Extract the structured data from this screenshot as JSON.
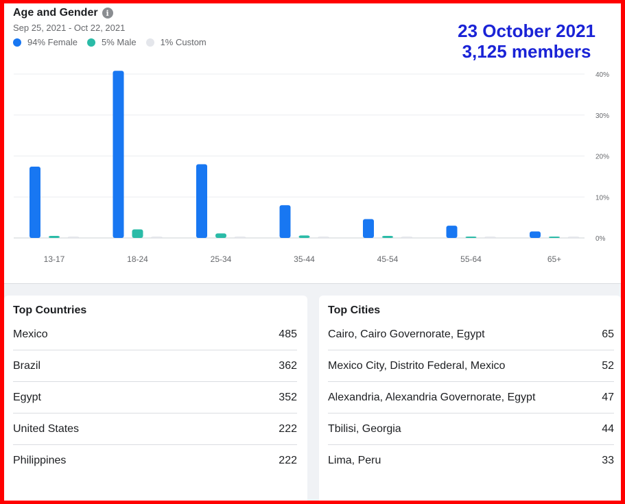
{
  "header": {
    "title": "Age and Gender",
    "date_range": "Sep 25, 2021 - Oct 22, 2021",
    "legend": [
      {
        "label": "94% Female",
        "color": "#1877f2"
      },
      {
        "label": "5% Male",
        "color": "#2abba7"
      },
      {
        "label": "1% Custom",
        "color": "#e4e6eb"
      }
    ]
  },
  "overlay": {
    "line1": "23 October 2021",
    "line2": "3,125 members"
  },
  "chart_data": {
    "type": "bar",
    "categories": [
      "13-17",
      "18-24",
      "25-34",
      "35-44",
      "45-54",
      "55-64",
      "65+"
    ],
    "series": [
      {
        "name": "94% Female",
        "color": "#1877f2",
        "values": [
          17.4,
          40.8,
          18.0,
          8.0,
          4.6,
          3.0,
          1.6
        ]
      },
      {
        "name": "5% Male",
        "color": "#2abba7",
        "values": [
          0.5,
          2.1,
          1.1,
          0.6,
          0.5,
          0.2,
          0.2
        ]
      },
      {
        "name": "1% Custom",
        "color": "#e4e6eb",
        "values": [
          0.2,
          0.2,
          0.1,
          0.05,
          0.05,
          0.05,
          0.05
        ]
      }
    ],
    "y_ticks": [
      "0%",
      "10%",
      "20%",
      "30%",
      "40%"
    ],
    "y_tick_values": [
      0,
      10,
      20,
      30,
      40
    ],
    "ylim": [
      0,
      40
    ],
    "y_axis_side": "right",
    "grid": true
  },
  "top_countries": {
    "title": "Top Countries",
    "rows": [
      {
        "name": "Mexico",
        "value": "485"
      },
      {
        "name": "Brazil",
        "value": "362"
      },
      {
        "name": "Egypt",
        "value": "352"
      },
      {
        "name": "United States",
        "value": "222"
      },
      {
        "name": "Philippines",
        "value": "222"
      }
    ]
  },
  "top_cities": {
    "title": "Top Cities",
    "rows": [
      {
        "name": "Cairo, Cairo Governorate, Egypt",
        "value": "65"
      },
      {
        "name": "Mexico City, Distrito Federal, Mexico",
        "value": "52"
      },
      {
        "name": "Alexandria, Alexandria Governorate, Egypt",
        "value": "47"
      },
      {
        "name": "Tbilisi, Georgia",
        "value": "44"
      },
      {
        "name": "Lima, Peru",
        "value": "33"
      }
    ]
  }
}
